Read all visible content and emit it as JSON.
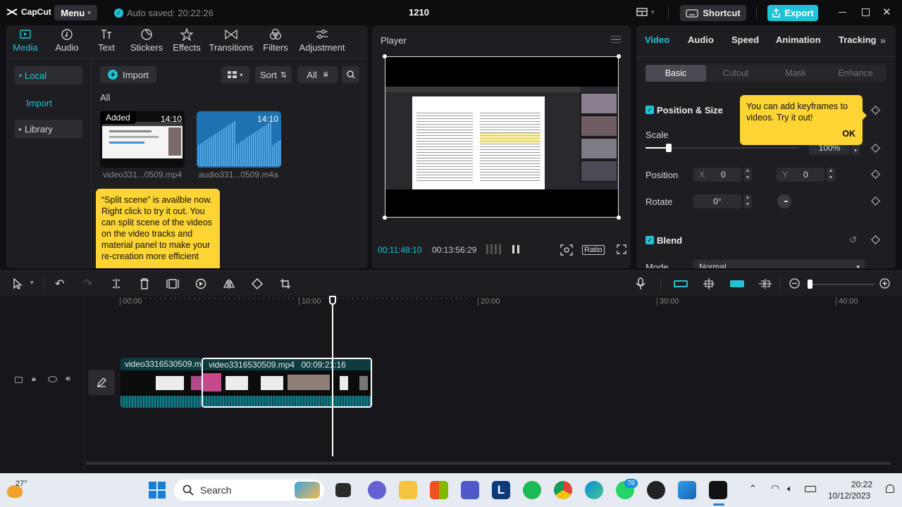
{
  "app": {
    "name": "CapCut",
    "menu_label": "Menu",
    "autosave_text": "Auto saved: 20:22:26",
    "project_title": "1210",
    "shortcut_label": "Shortcut",
    "export_label": "Export"
  },
  "media_tabs": [
    {
      "label": "Media",
      "icon": "media-icon"
    },
    {
      "label": "Audio",
      "icon": "audio-icon"
    },
    {
      "label": "Text",
      "icon": "text-icon"
    },
    {
      "label": "Stickers",
      "icon": "stickers-icon"
    },
    {
      "label": "Effects",
      "icon": "effects-icon"
    },
    {
      "label": "Transitions",
      "icon": "transitions-icon"
    },
    {
      "label": "Filters",
      "icon": "filters-icon"
    },
    {
      "label": "Adjustment",
      "icon": "adjustment-icon"
    }
  ],
  "sidebar": {
    "local": "Local",
    "import": "Import",
    "library": "Library"
  },
  "media_toolbar": {
    "import_label": "Import",
    "sort_label": "Sort",
    "filter_label": "All",
    "section_label": "All"
  },
  "media_items": [
    {
      "name": "video331...0509.mp4",
      "duration": "14:10",
      "badge": "Added"
    },
    {
      "name": "audio331...0509.m4a",
      "duration": "14:10"
    }
  ],
  "split_tip": "“Split scene”   is availble now. Right click to try it out. You can split scene of the videos on the video tracks and material panel to make your re-creation more efficient",
  "player": {
    "title": "Player",
    "current_time": "00:11:48:10",
    "total_time": "00:13:56:29",
    "ratio_label": "Ratio"
  },
  "inspector": {
    "tabs": [
      "Video",
      "Audio",
      "Speed",
      "Animation",
      "Tracking"
    ],
    "subtabs": [
      "Basic",
      "Cutout",
      "Mask",
      "Enhance"
    ],
    "position_size_label": "Position & Size",
    "scale_label": "Scale",
    "scale_value": "100%",
    "scale_fraction": 0.15,
    "position_label": "Position",
    "x_label": "X",
    "x_value": "0",
    "y_label": "Y",
    "y_value": "0",
    "rotate_label": "Rotate",
    "rotate_value": "0°",
    "blend_label": "Blend",
    "mode_label": "Mode",
    "mode_value": "Normal",
    "keyframe_tip": "You can add keyframes to videos. Try it out!",
    "keyframe_ok": "OK"
  },
  "timeline": {
    "ruler_labels": [
      "00:00",
      "10:00",
      "20:00",
      "30:00",
      "40:00"
    ],
    "clip1_label": "video3316530509.m",
    "clip2_label": "video3316530509.mp4",
    "clip2_duration": "00:09:21:16"
  },
  "taskbar": {
    "temperature": "27°",
    "search_placeholder": "Search",
    "teams_badge": "76",
    "time": "20:22",
    "date": "10/12/2023"
  },
  "colors": {
    "accent": "#1fc3d6",
    "tooltip": "#fcd433",
    "bg": "#1d1d22"
  }
}
